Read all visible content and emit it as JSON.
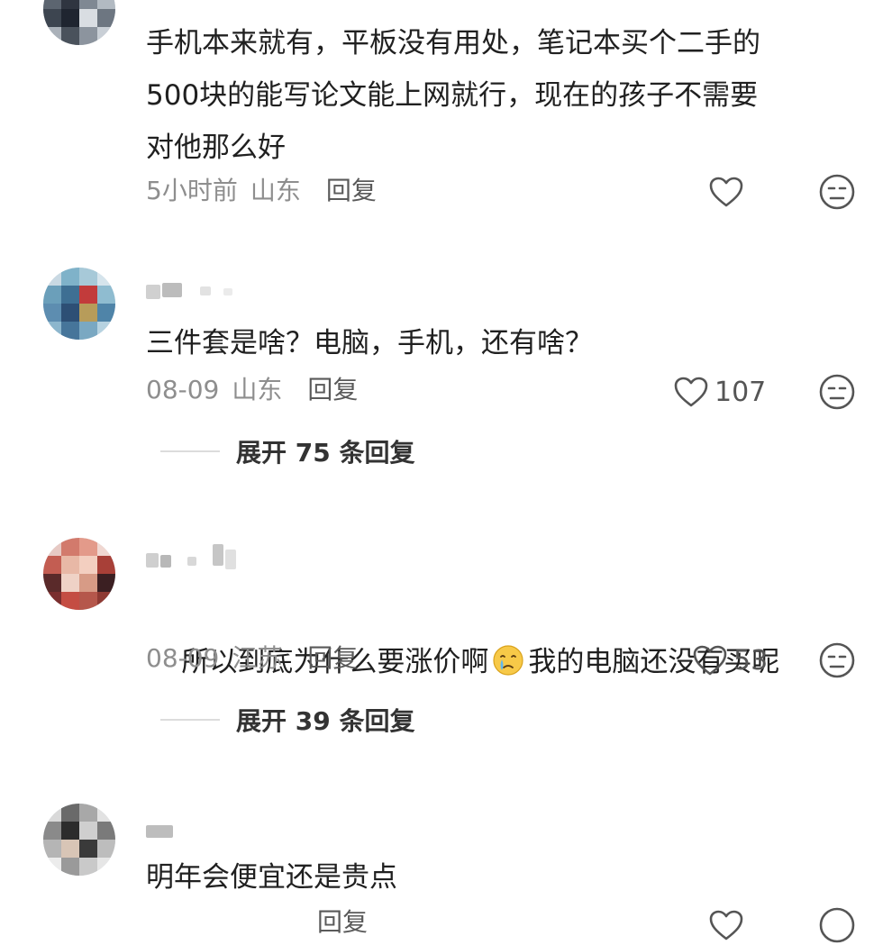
{
  "comments": [
    {
      "text": "手机本来就有，平板没有用处，笔记本买个二手的\n500块的能写论文能上网就行，现在的孩子不需要\n对他那么好",
      "time": "5小时前",
      "location": "山东",
      "reply": "回复",
      "likes": ""
    },
    {
      "text": "三件套是啥？电脑，手机，还有啥？",
      "time": "08-09",
      "location": "山东",
      "reply": "回复",
      "likes": "107",
      "expand": "展开 75 条回复"
    },
    {
      "text_before": "所以到底为什么要涨价啊",
      "emoji": "crying-face-icon",
      "text_after": "我的电脑还没有买呢",
      "time": "08-09",
      "location": "江苏",
      "reply": "回复",
      "likes": "53",
      "expand": "展开 39 条回复"
    },
    {
      "text": "明年会便宜还是贵点",
      "reply": "回复"
    }
  ],
  "colors": {
    "text": "#202020",
    "meta": "#8e8e8e",
    "icon": "#555555"
  }
}
